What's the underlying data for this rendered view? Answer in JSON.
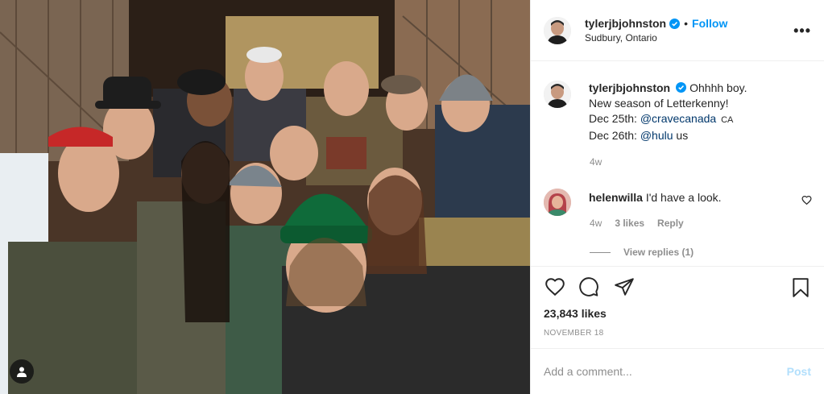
{
  "post": {
    "username": "tylerjbjohnston",
    "follow_label": "Follow",
    "location": "Sudbury, Ontario",
    "more_label": "•••"
  },
  "caption": {
    "username": "tylerjbjohnston",
    "line1": "Ohhhh boy.",
    "line2": "New season of Letterkenny!",
    "line3_prefix": "Dec 25th:",
    "line3_link": "@cravecanada",
    "line3_suffix": "CA",
    "line4_prefix": "Dec 26th:",
    "line4_link": "@hulu",
    "line4_suffix": "us",
    "time": "4w"
  },
  "comment": {
    "username": "helenwilla",
    "text": "I'd have a look.",
    "time": "4w",
    "likes": "3 likes",
    "reply": "Reply",
    "view_replies": "View replies (1)"
  },
  "actions": {
    "likes": "23,843 likes",
    "date": "NOVEMBER 18"
  },
  "add_comment": {
    "placeholder": "Add a comment...",
    "post_label": "Post"
  },
  "icons": {
    "verified": "verified-badge-icon",
    "like": "heart-icon",
    "comment": "comment-bubble-icon",
    "share": "paper-plane-icon",
    "save": "bookmark-icon",
    "tag": "user-tag-icon",
    "more": "more-options-icon"
  },
  "colors": {
    "accent": "#0095f6",
    "link": "#00376b",
    "muted": "#8e8e8e",
    "post_disabled": "#b2dffc"
  }
}
